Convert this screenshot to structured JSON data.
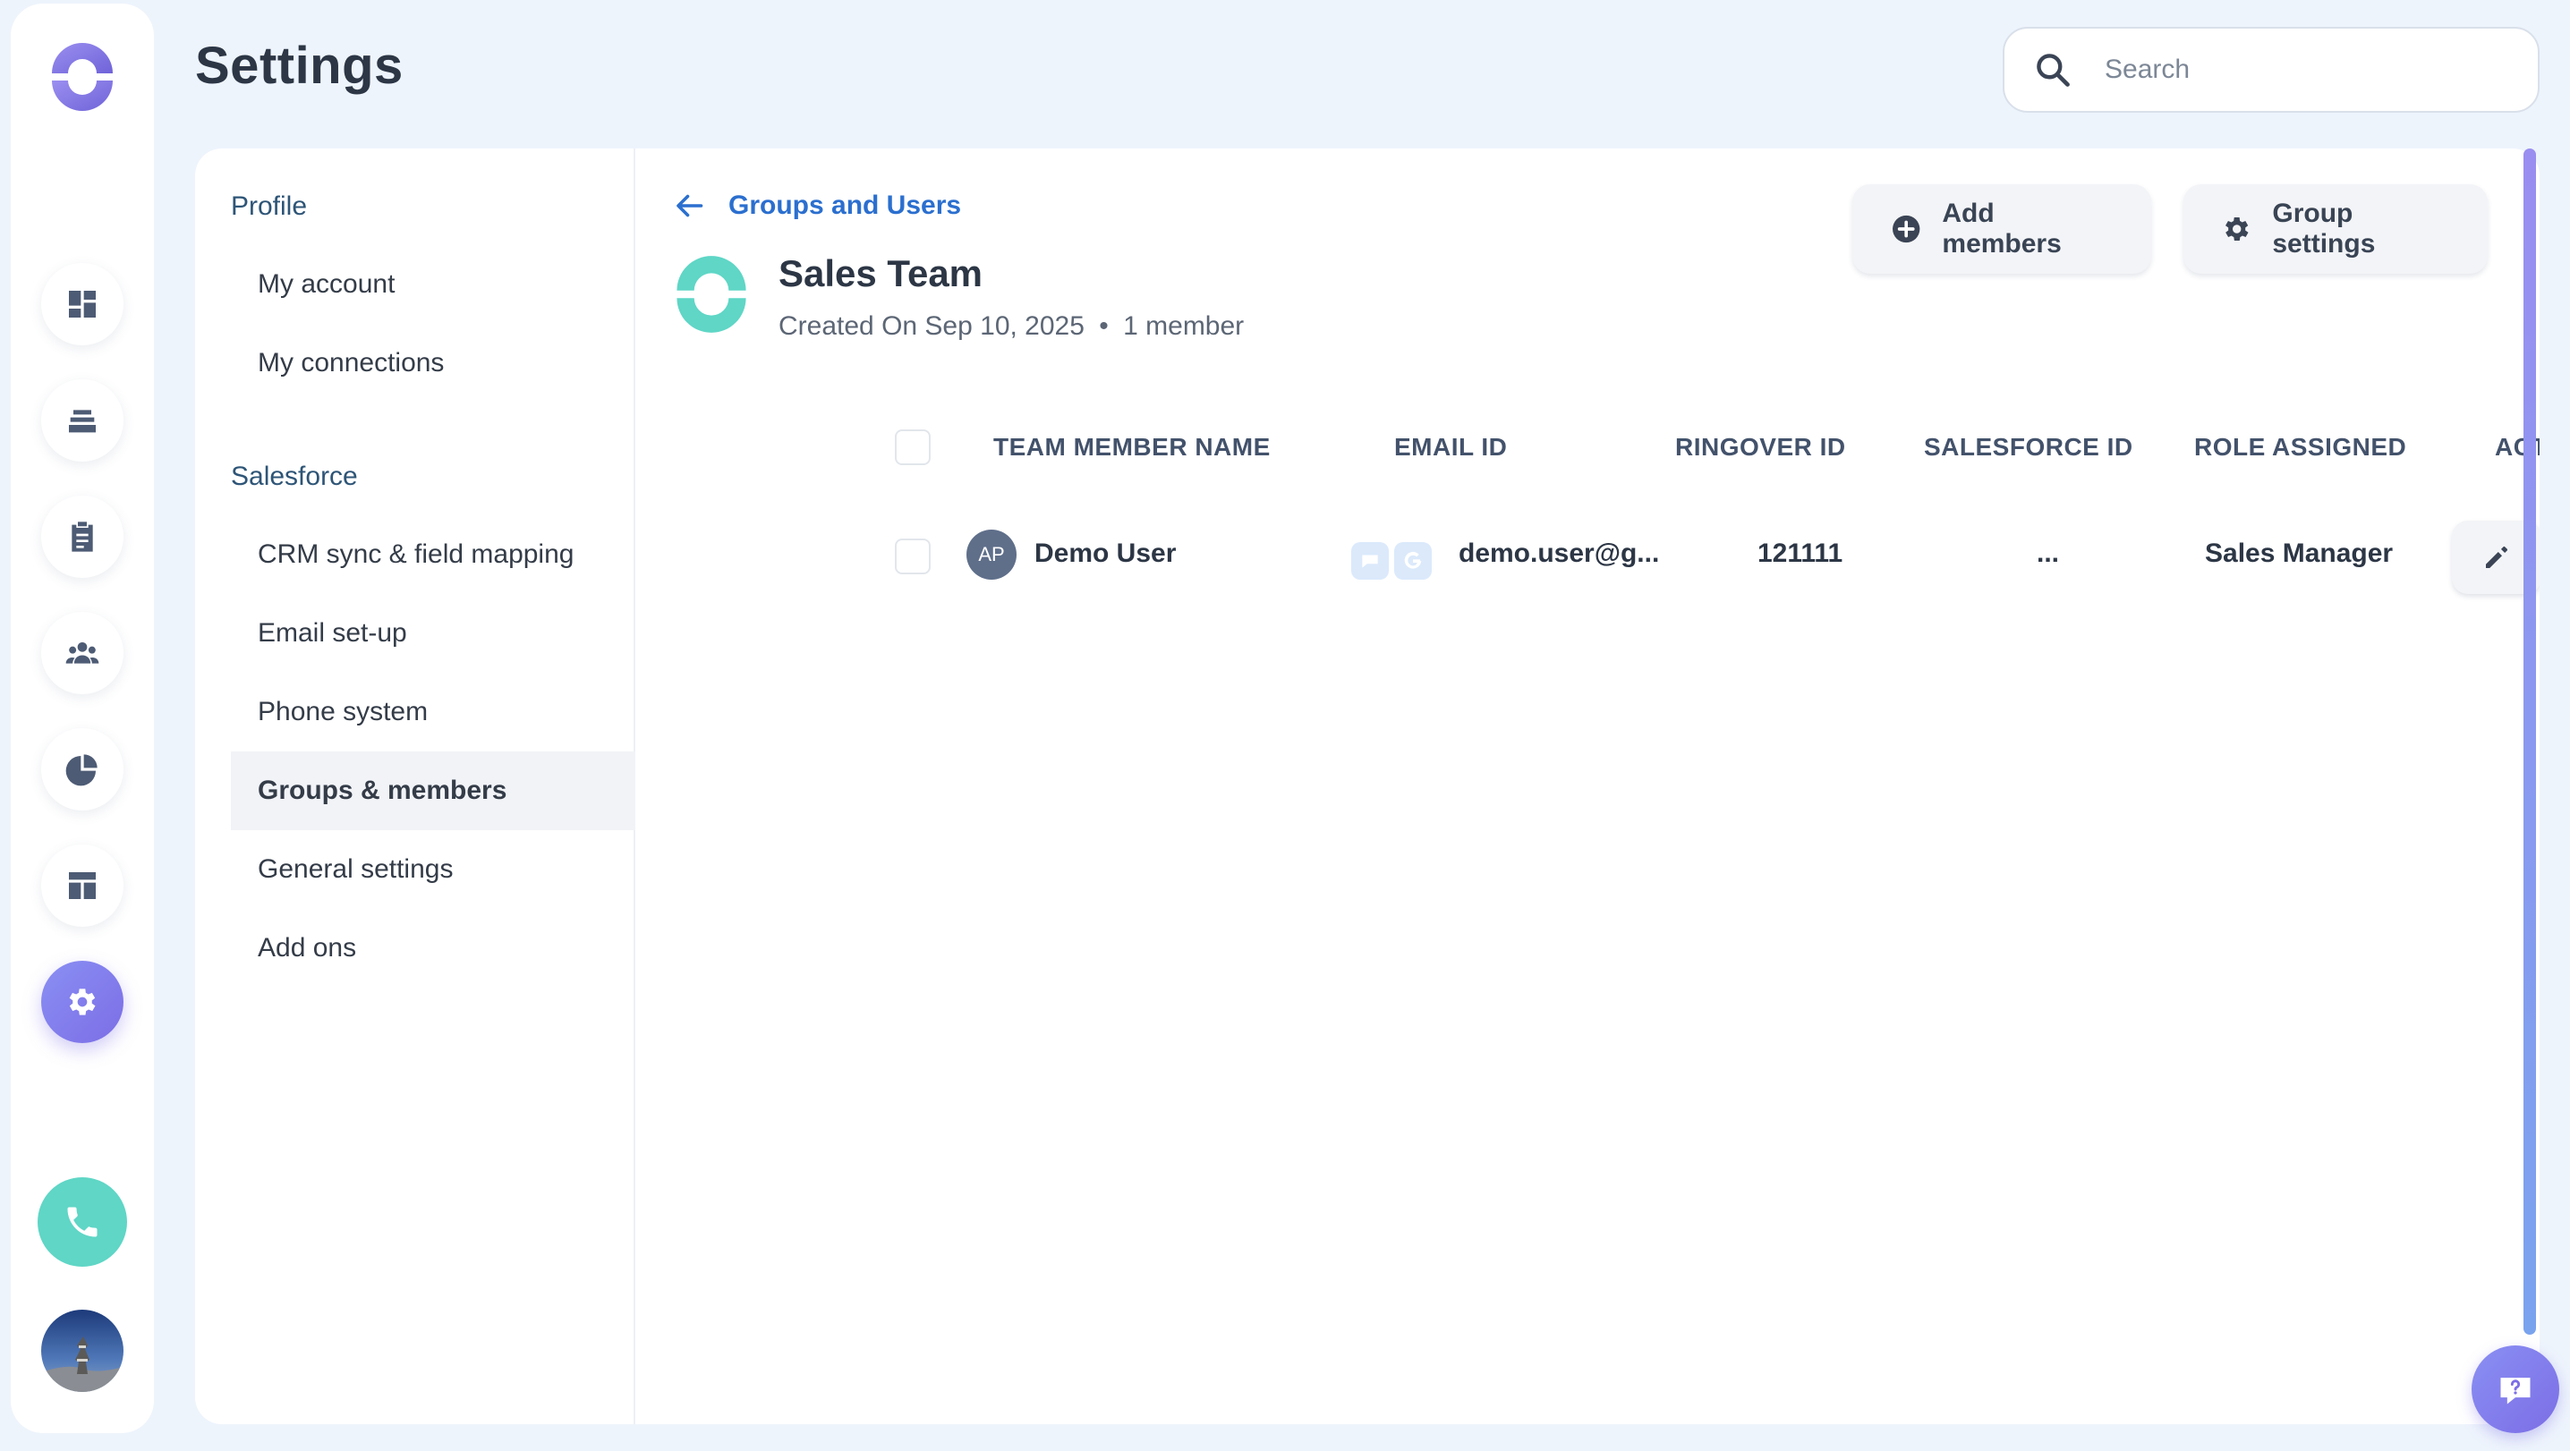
{
  "header": {
    "title": "Settings"
  },
  "search": {
    "placeholder": "Search",
    "value": ""
  },
  "rail": {
    "icons": [
      "logo-icon",
      "dashboard-icon",
      "cadence-icon",
      "tasks-icon",
      "people-icon",
      "reports-icon",
      "templates-icon",
      "settings-icon",
      "phone-icon",
      "user-avatar"
    ],
    "active": "settings-icon",
    "accent": "#7c6ee6",
    "phone_color": "#5fd6c6"
  },
  "menu": {
    "profile_label": "Profile",
    "profile_items": [
      "My account",
      "My connections"
    ],
    "salesforce_label": "Salesforce",
    "salesforce_items": [
      "CRM sync & field mapping",
      "Email set-up",
      "Phone system",
      "Groups & members",
      "General settings",
      "Add ons"
    ],
    "active": "Groups & members"
  },
  "group": {
    "back_label": "Groups and Users",
    "name": "Sales Team",
    "created": "Created On Sep 10, 2025",
    "separator": "•",
    "member_count": "1 member",
    "add_members_label": "Add members",
    "group_settings_label": "Group settings"
  },
  "table": {
    "headers": [
      "TEAM MEMBER NAME",
      "EMAIL ID",
      "RINGOVER ID",
      "SALESFORCE ID",
      "ROLE ASSIGNED",
      "ACTIONS"
    ],
    "rows": [
      {
        "initials": "AP",
        "name": "Demo User",
        "email": "demo.user@g...",
        "ringover_id": "121111",
        "salesforce_id": "...",
        "role": "Sales Manager"
      }
    ]
  }
}
